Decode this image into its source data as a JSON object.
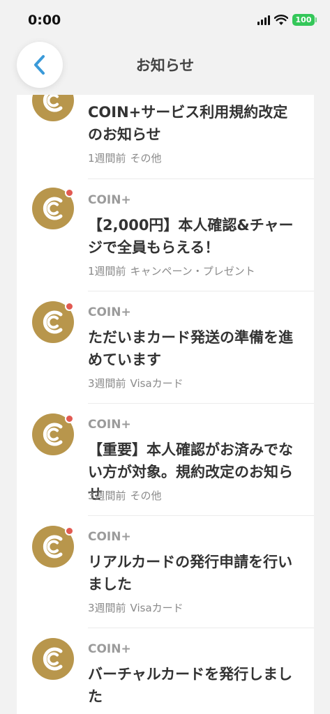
{
  "status_bar": {
    "time": "0:00",
    "battery": "100",
    "battery_color": "#34c759"
  },
  "header": {
    "title": "お知らせ",
    "back_icon": "chevron-left-icon",
    "accent_color": "#3a9ad9"
  },
  "brand_color": "#b8964c",
  "notifications": [
    {
      "sender": "",
      "title": "COIN+サービス利用規約改定のお知らせ",
      "time": "1週間前",
      "category": "その他",
      "unread": false
    },
    {
      "sender": "COIN+",
      "title": "【2,000円】本人確認&チャージで全員もらえる！",
      "time": "1週間前",
      "category": "キャンペーン・プレゼント",
      "unread": true
    },
    {
      "sender": "COIN+",
      "title": "ただいまカード発送の準備を進めています",
      "time": "3週間前",
      "category": "Visaカード",
      "unread": true
    },
    {
      "sender": "COIN+",
      "title": "【重要】本人確認がお済みでない方が対象。規約改定のお知らせ",
      "time": "3週間前",
      "category": "その他",
      "unread": true
    },
    {
      "sender": "COIN+",
      "title": "リアルカードの発行申請を行いました",
      "time": "3週間前",
      "category": "Visaカード",
      "unread": true
    },
    {
      "sender": "COIN+",
      "title": "バーチャルカードを発行しました",
      "time": "",
      "category": "",
      "unread": false
    }
  ]
}
